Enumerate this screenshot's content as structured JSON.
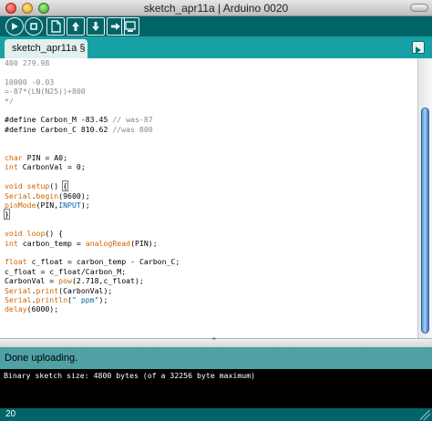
{
  "window": {
    "title": "sketch_apr11a | Arduino 0020"
  },
  "toolbar": {
    "buttons": [
      {
        "name": "verify",
        "icon": "play-icon"
      },
      {
        "name": "stop",
        "icon": "stop-icon"
      },
      {
        "name": "new",
        "icon": "new-file-icon"
      },
      {
        "name": "open",
        "icon": "open-arrow-up-icon"
      },
      {
        "name": "save",
        "icon": "save-arrow-down-icon"
      },
      {
        "name": "upload",
        "icon": "upload-arrow-right-icon"
      },
      {
        "name": "serial-monitor",
        "icon": "serial-monitor-icon"
      }
    ]
  },
  "tabs": {
    "active": "sketch_apr11a §",
    "menu_icon": "tab-menu-arrow-icon"
  },
  "editor": {
    "lines": [
      "400 279.98",
      "",
      "10000 -0.03",
      "=-87*(LN(N25))+800",
      "*/",
      "",
      "#define Carbon_M -83.45 // was-87",
      "#define Carbon_C 810.62 //was 800",
      "",
      "",
      "char PIN = A0;",
      "int CarbonVal = 0;",
      "",
      "void setup() {",
      "Serial.begin(9600);",
      "pinMode(PIN,INPUT);",
      "}",
      "",
      "void loop() {",
      "int carbon_temp = analogRead(PIN);",
      "",
      "float c_float = carbon_temp - Carbon_C;",
      "c_float = c_float/Carbon_M;",
      "CarbonVal = pow(2.718,c_float);",
      "Serial.print(CarbonVal);",
      "Serial.println(\" ppm\");",
      "delay(6000);"
    ]
  },
  "status": {
    "message": "Done uploading."
  },
  "console": {
    "output": "Binary sketch size: 4800 bytes (of a 32256 byte maximum)"
  },
  "footer": {
    "line_number": "20"
  },
  "colors": {
    "toolbar": "#006468",
    "tabbar": "#17a1a5",
    "status": "#4fa1a6",
    "keyword": "#cc6600",
    "constant": "#0066aa",
    "comment": "#888888"
  }
}
